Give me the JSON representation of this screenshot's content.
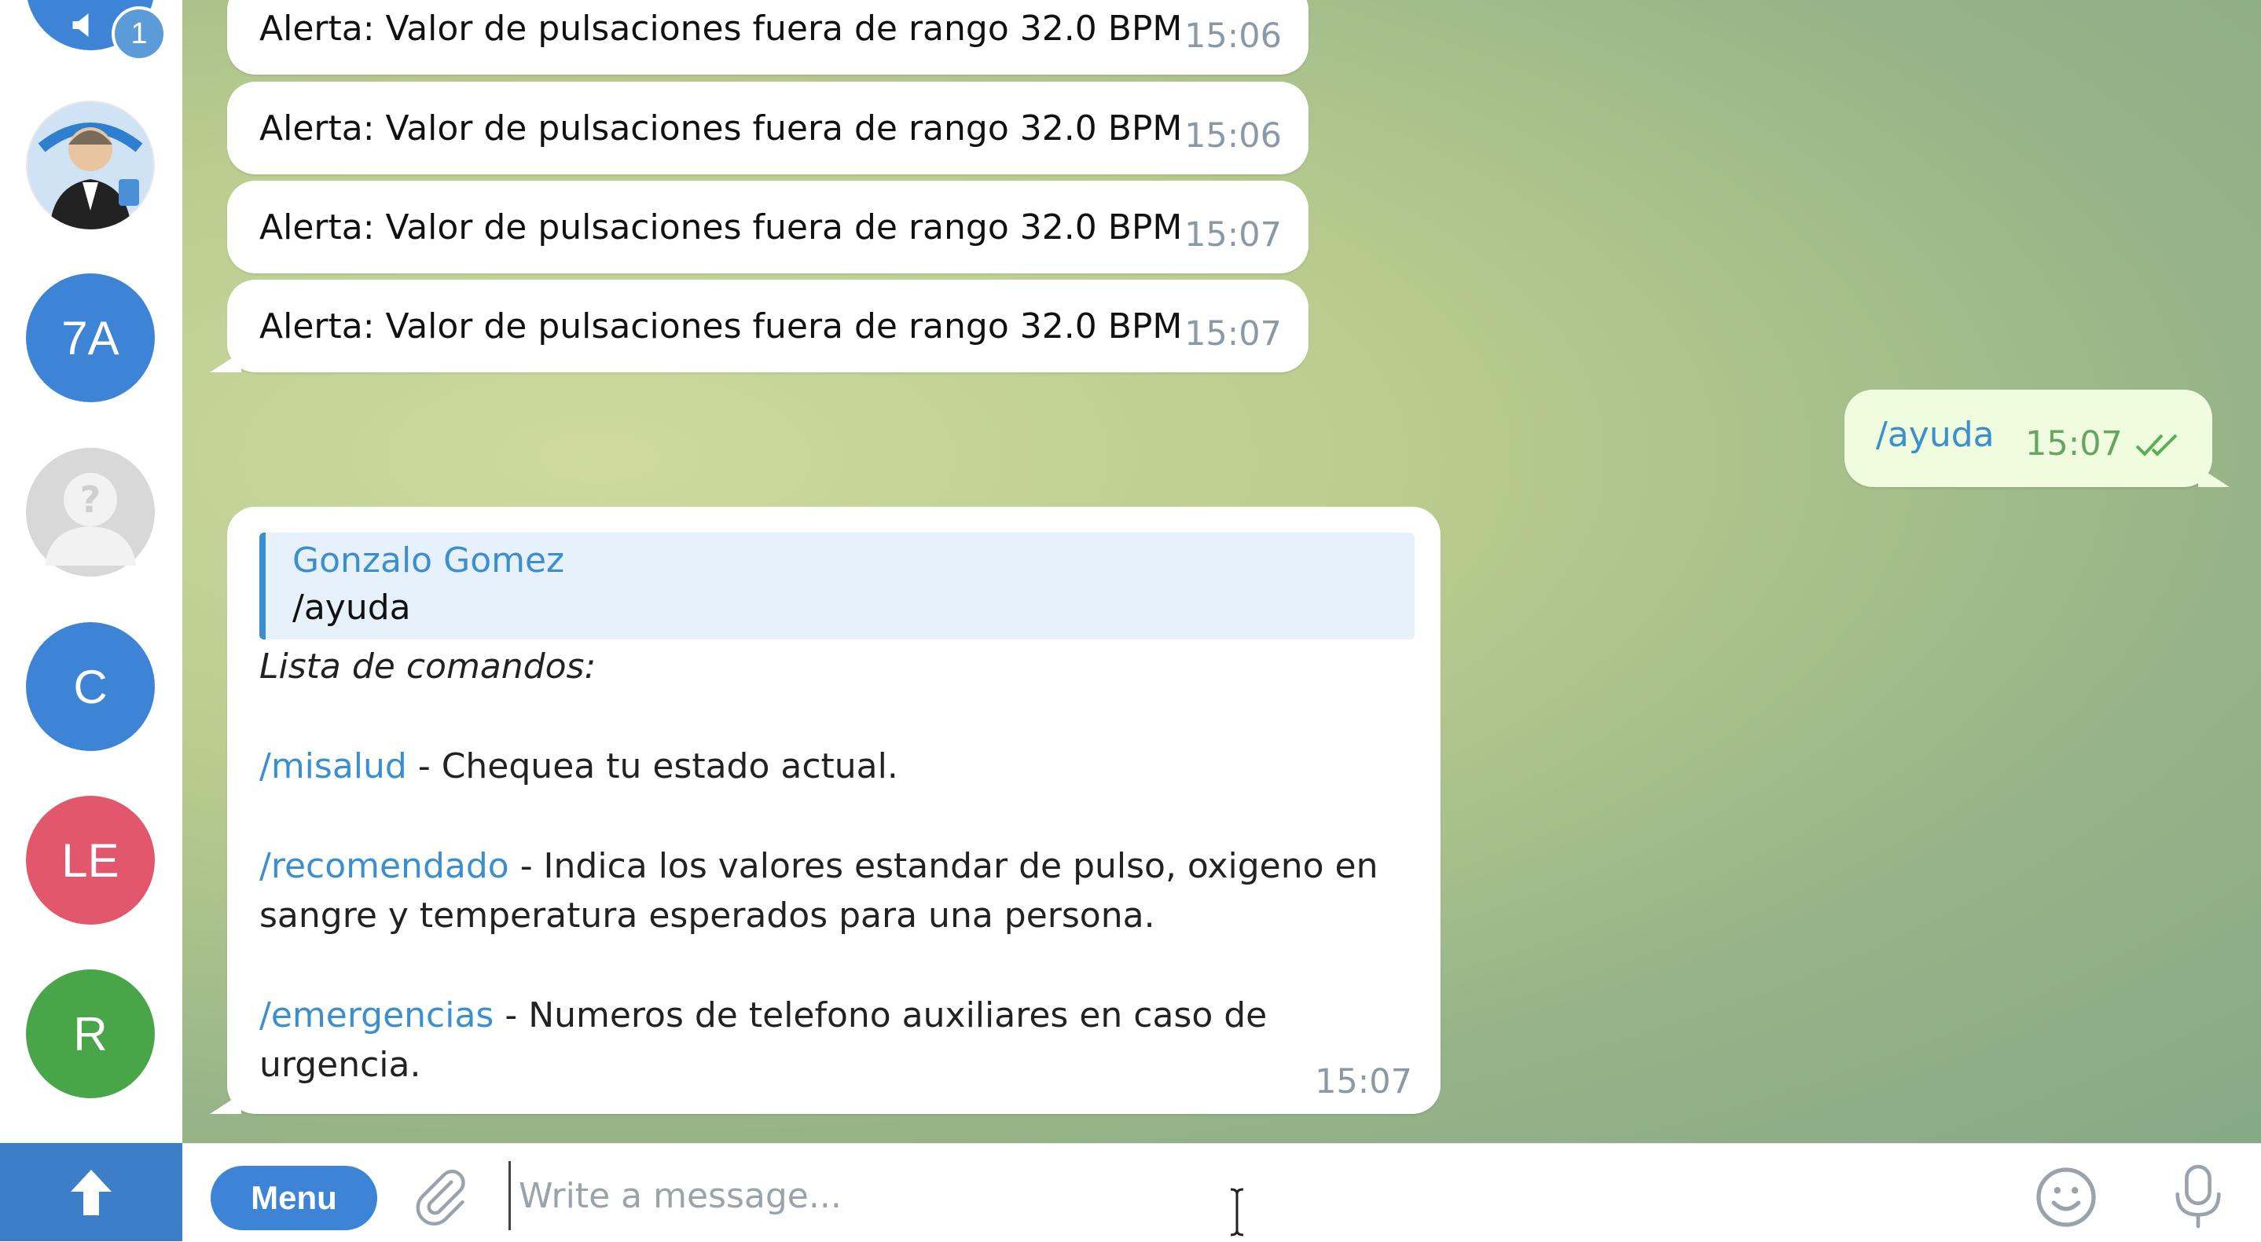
{
  "sidebar": {
    "badge_count": "1",
    "avatars": [
      {
        "initials": "7A",
        "color": "#3d84d6"
      },
      {
        "initials": "C",
        "color": "#3d84d6"
      },
      {
        "initials": "LE",
        "color": "#e2576b"
      },
      {
        "initials": "R",
        "color": "#48a548"
      }
    ]
  },
  "chat": {
    "alerts": [
      {
        "text": "Alerta: Valor de pulsaciones fuera de rango 32.0 BPM",
        "time": "15:06"
      },
      {
        "text": "Alerta: Valor de pulsaciones fuera de rango 32.0 BPM",
        "time": "15:06"
      },
      {
        "text": "Alerta: Valor de pulsaciones fuera de rango 32.0 BPM",
        "time": "15:07"
      },
      {
        "text": "Alerta: Valor de pulsaciones fuera de rango 32.0 BPM",
        "time": "15:07"
      }
    ],
    "outgoing": {
      "text": "/ayuda",
      "time": "15:07",
      "status": "read"
    },
    "reply": {
      "quote_author": "Gonzalo Gomez",
      "quote_text": "/ayuda",
      "header": "Lista de comandos:",
      "commands": [
        {
          "cmd": "/misalud",
          "desc_1": " - Chequea tu estado actual.",
          "desc_2": ""
        },
        {
          "cmd": "/recomendado",
          "desc_1": " - Indica los valores estandar de pulso, oxigeno en",
          "desc_2": "sangre y temperatura esperados para una persona."
        },
        {
          "cmd": "/emergencias",
          "desc_1": " - Numeros de telefono auxiliares en caso de",
          "desc_2": "urgencia."
        }
      ],
      "time": "15:07"
    }
  },
  "composer": {
    "menu_label": "Menu",
    "placeholder": "Write a message..."
  },
  "colors": {
    "accent": "#3b8ed0",
    "outgoing_bubble": "#effdde",
    "sidebar_button": "#3d7ec8"
  }
}
